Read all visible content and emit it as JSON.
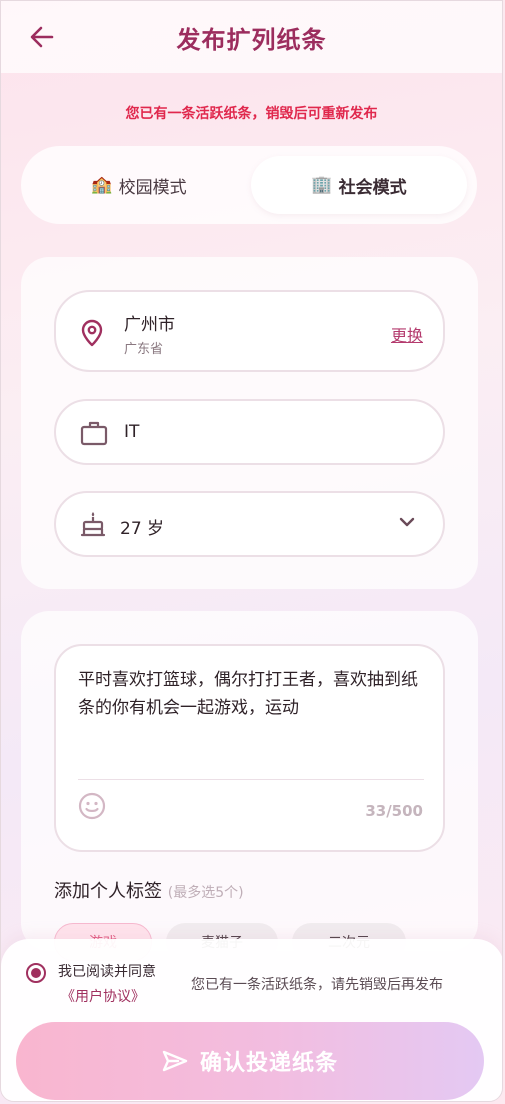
{
  "header": {
    "title": "发布扩列纸条"
  },
  "notice": "您已有一条活跃纸条，销毁后可重新发布",
  "mode_switch": {
    "campus": {
      "label": "校园模式",
      "icon": "🏫"
    },
    "social": {
      "label": "社会模式",
      "icon": "🏢"
    },
    "selected": "社会模式"
  },
  "profile": {
    "location": {
      "city": "广州市",
      "province": "广东省",
      "change_label": "更换"
    },
    "occupation": "IT",
    "age": "27 岁"
  },
  "bio": {
    "text": "平时喜欢打篮球，偶尔打打王者，喜欢抽到纸条的你有机会一起游戏，运动",
    "count": "33/500"
  },
  "tags": {
    "title": "添加个人标签",
    "hint": "(最多选5个)",
    "items": [
      {
        "label": "游戏"
      },
      {
        "label": "麦猫子"
      },
      {
        "label": "二次元"
      }
    ]
  },
  "bottom": {
    "agree_text": "我已阅读并同意",
    "agreement_link": "《用户协议》",
    "active_notice": "您已有一条活跃纸条，请先销毁后再发布",
    "submit_label": "确认投递纸条"
  },
  "colors": {
    "accent": "#9c2d5e",
    "warning": "#e0284d",
    "link": "#b43b6e"
  }
}
